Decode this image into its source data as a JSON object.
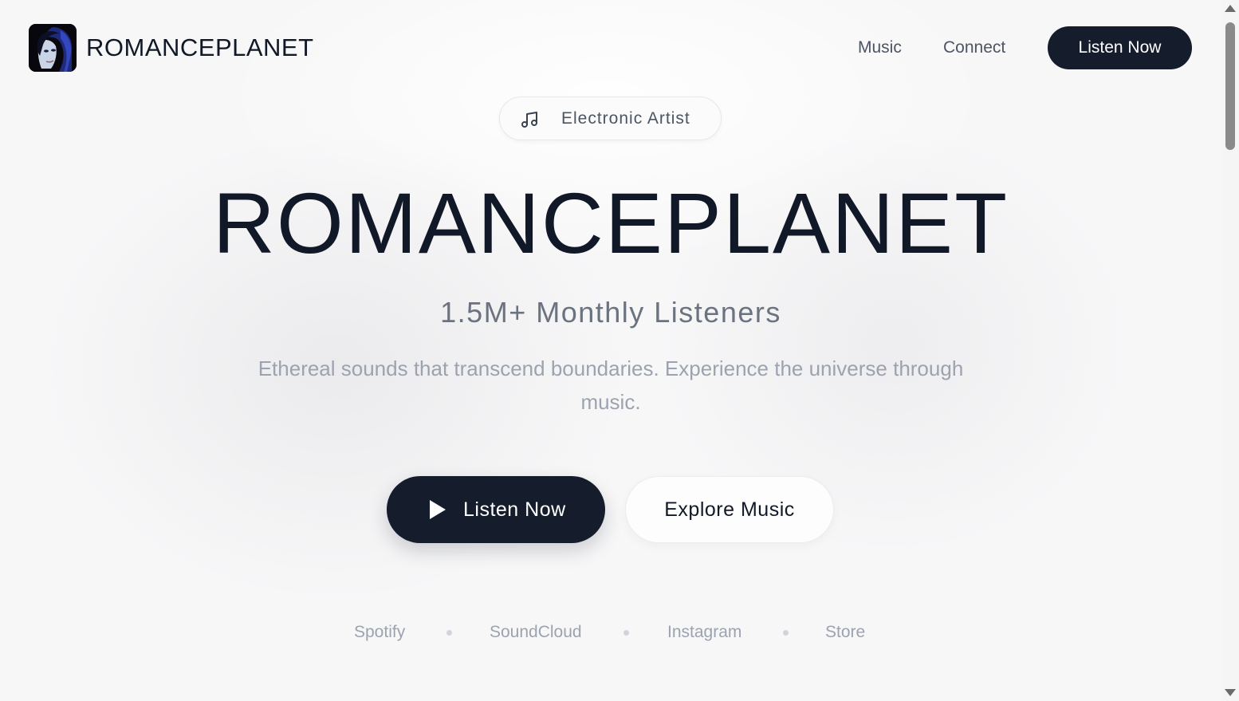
{
  "header": {
    "brand": "ROMANCEPLANET",
    "avatar_icon": "artist-avatar",
    "nav": [
      {
        "label": "Music"
      },
      {
        "label": "Connect"
      }
    ],
    "cta_label": "Listen Now"
  },
  "badge": {
    "icon": "music-note-icon",
    "label": "Electronic Artist"
  },
  "hero": {
    "title": "ROMANCEPLANET",
    "listeners": "1.5M+ Monthly Listeners",
    "description": "Ethereal sounds that transcend boundaries. Experience the universe through music.",
    "primary_button": {
      "label": "Listen Now",
      "icon": "play-icon"
    },
    "secondary_button": {
      "label": "Explore Music"
    }
  },
  "platforms": [
    {
      "label": "Spotify"
    },
    {
      "label": "SoundCloud"
    },
    {
      "label": "Instagram"
    },
    {
      "label": "Store"
    }
  ],
  "colors": {
    "primary": "#151c2c",
    "text": "#111827",
    "muted": "#9ca3af",
    "background": "#f8f8f9"
  }
}
